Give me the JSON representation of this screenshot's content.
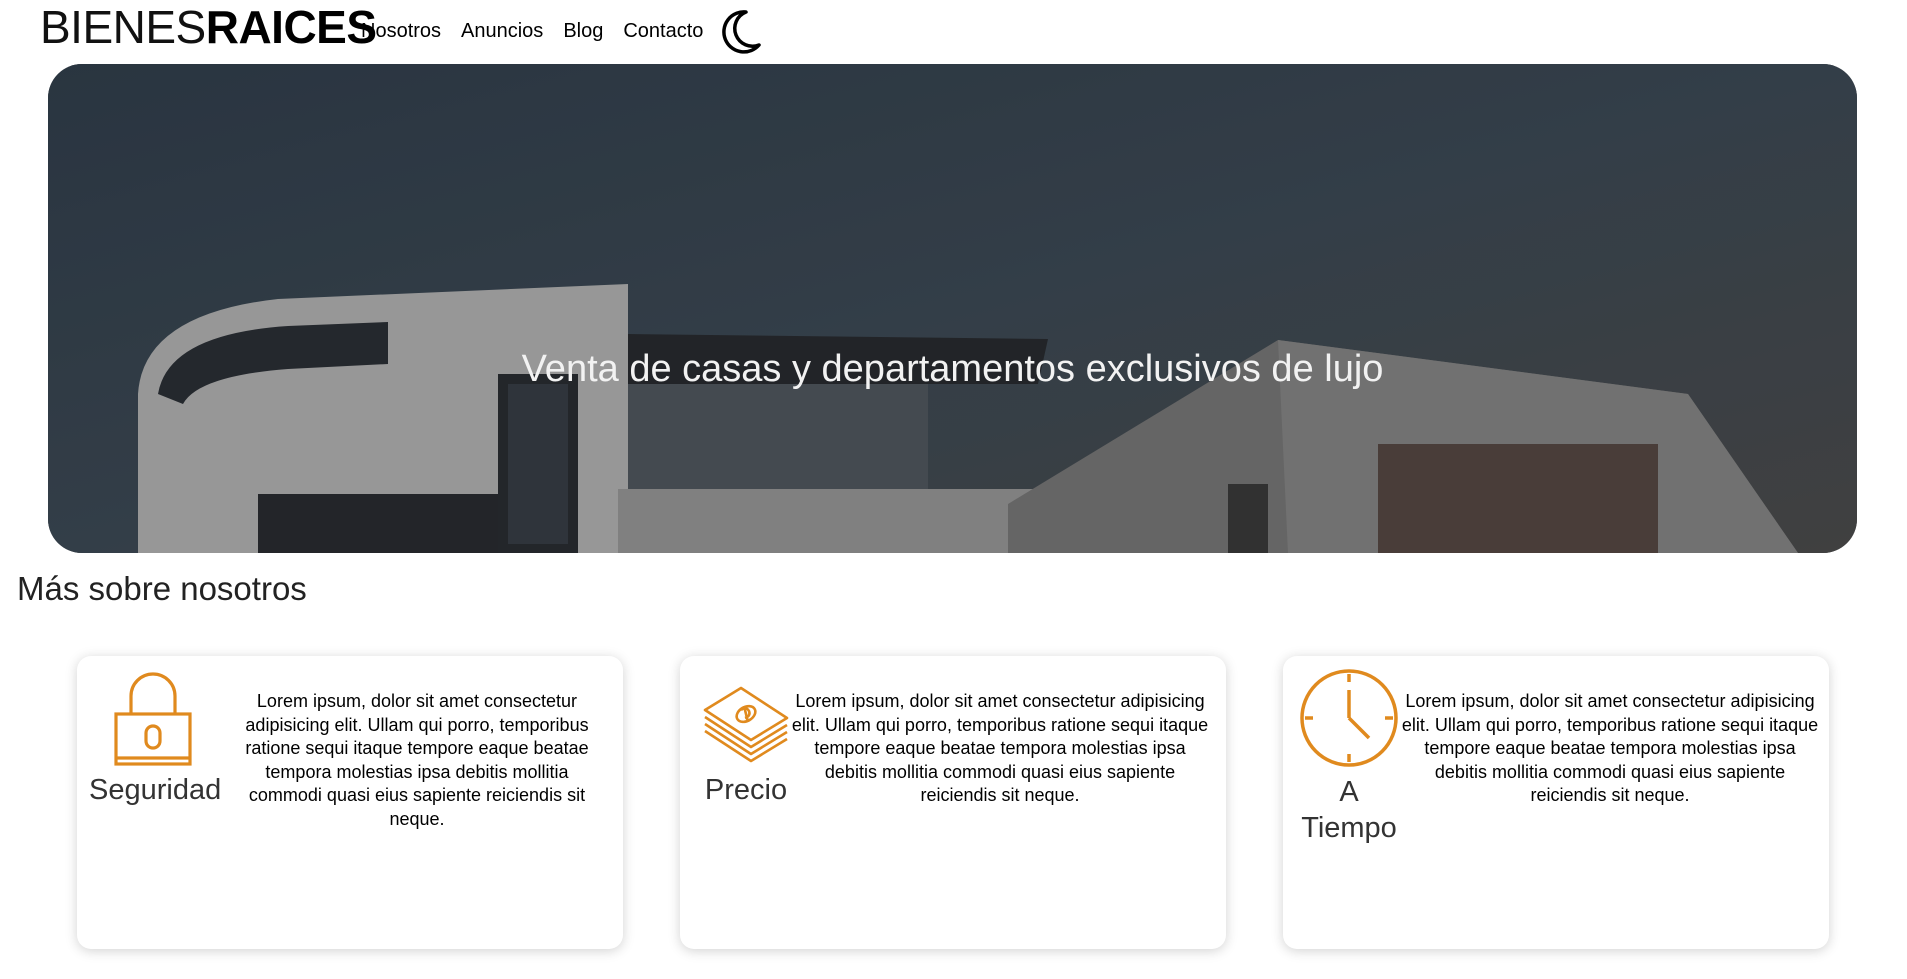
{
  "header": {
    "logo_light": "BIENES",
    "logo_bold": "RAICES",
    "nav": [
      "Nosotros",
      "Anuncios",
      "Blog",
      "Contacto"
    ]
  },
  "hero": {
    "title": "Venta de casas y departamentos exclusivos de lujo"
  },
  "about": {
    "title": "Más sobre nosotros",
    "cards": [
      {
        "icon": "lock-icon",
        "label": "Seguridad",
        "text": "Lorem ipsum, dolor sit amet consectetur adipisicing elit. Ullam qui porro, temporibus ratione sequi itaque tempore eaque beatae tempora molestias ipsa debitis mollitia commodi quasi eius sapiente reiciendis sit neque."
      },
      {
        "icon": "money-icon",
        "label": "Precio",
        "text": "Lorem ipsum, dolor sit amet consectetur adipisicing elit. Ullam qui porro, temporibus ratione sequi itaque tempore eaque beatae tempora molestias ipsa debitis mollitia commodi quasi eius sapiente reiciendis sit neque."
      },
      {
        "icon": "clock-icon",
        "label": "A Tiempo",
        "text": "Lorem ipsum, dolor sit amet consectetur adipisicing elit. Ullam qui porro, temporibus ratione sequi itaque tempore eaque beatae tempora molestias ipsa debitis mollitia commodi quasi eius sapiente reiciendis sit neque."
      }
    ]
  },
  "colors": {
    "accent": "#E08A1E",
    "hero_overlay": "#4a4a4a"
  }
}
